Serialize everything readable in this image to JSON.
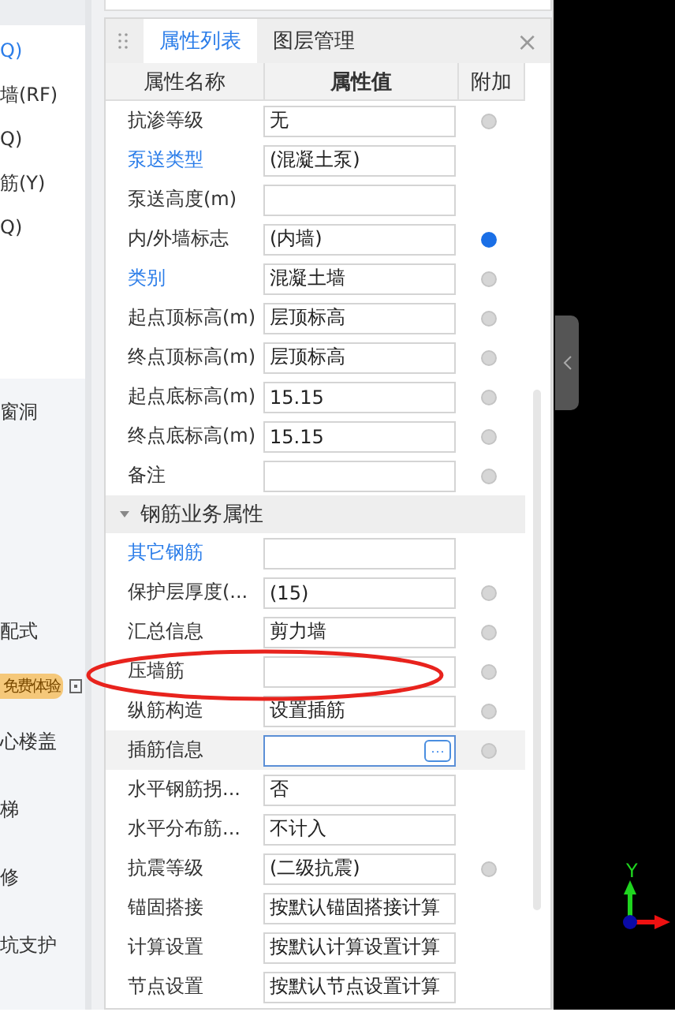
{
  "sidebar": {
    "items": [
      {
        "label": "Q)",
        "link": true
      },
      {
        "label": "墙(RF)",
        "link": false
      },
      {
        "label": "Q)",
        "link": false
      },
      {
        "label": "筋(Y)",
        "link": false
      },
      {
        "label": "Q)",
        "link": false
      }
    ],
    "groups": [
      {
        "kind": "item",
        "label": "窗洞"
      },
      {
        "kind": "item",
        "label": "配式"
      },
      {
        "kind": "badge",
        "label": "免费体验"
      },
      {
        "kind": "item",
        "label": "心楼盖"
      },
      {
        "kind": "item",
        "label": "梯"
      },
      {
        "kind": "item",
        "label": "修"
      },
      {
        "kind": "item",
        "label": "坑支护"
      }
    ]
  },
  "panel": {
    "tabs": [
      {
        "label": "属性列表",
        "selected": true
      },
      {
        "label": "图层管理",
        "selected": false
      }
    ],
    "close": "×",
    "columns": [
      "属性名称",
      "属性值",
      "附加"
    ],
    "rows": [
      {
        "kind": "text",
        "name": "抗渗等级",
        "value": "无",
        "link": false,
        "attached": false,
        "selected": false
      },
      {
        "kind": "text",
        "name": "泵送类型",
        "value": "(混凝土泵)",
        "link": true,
        "selected": false
      },
      {
        "kind": "text",
        "name": "泵送高度(m)",
        "value": "",
        "link": false,
        "selected": false
      },
      {
        "kind": "text",
        "name": "内/外墙标志",
        "value": "(内墙)",
        "link": false,
        "attached": true,
        "selected": false
      },
      {
        "kind": "text",
        "name": "类别",
        "value": "混凝土墙",
        "link": true,
        "attached": false,
        "selected": false
      },
      {
        "kind": "text",
        "name": "起点顶标高(m)",
        "value": "层顶标高",
        "link": false,
        "attached": false,
        "selected": false
      },
      {
        "kind": "text",
        "name": "终点顶标高(m)",
        "value": "层顶标高",
        "link": false,
        "attached": false,
        "selected": false
      },
      {
        "kind": "text",
        "name": "起点底标高(m)",
        "value": "15.15",
        "link": false,
        "attached": false,
        "selected": false
      },
      {
        "kind": "text",
        "name": "终点底标高(m)",
        "value": "15.15",
        "link": false,
        "attached": false,
        "selected": false
      },
      {
        "kind": "text",
        "name": "备注",
        "value": "",
        "link": false,
        "attached": false,
        "selected": false
      },
      {
        "kind": "section",
        "name": "钢筋业务属性",
        "expanded": true
      },
      {
        "kind": "text",
        "name": "其它钢筋",
        "value": "",
        "link": true,
        "selected": false
      },
      {
        "kind": "text",
        "name": "保护层厚度(...",
        "value": "(15)",
        "link": false,
        "attached": false,
        "selected": false
      },
      {
        "kind": "text",
        "name": "汇总信息",
        "value": "剪力墙",
        "link": false,
        "attached": false,
        "selected": false
      },
      {
        "kind": "text",
        "name": "压墙筋",
        "value": "",
        "link": false,
        "attached": false,
        "selected": false
      },
      {
        "kind": "text",
        "name": "纵筋构造",
        "value": "设置插筋",
        "link": false,
        "attached": false,
        "selected": false
      },
      {
        "kind": "picker",
        "name": "插筋信息",
        "value": "",
        "button": "···",
        "link": false,
        "attached": false,
        "selected": true
      },
      {
        "kind": "text",
        "name": "水平钢筋拐...",
        "value": "否",
        "link": false,
        "selected": false
      },
      {
        "kind": "text",
        "name": "水平分布筋...",
        "value": "不计入",
        "link": false,
        "selected": false
      },
      {
        "kind": "text",
        "name": "抗震等级",
        "value": "(二级抗震)",
        "link": false,
        "attached": false,
        "selected": false
      },
      {
        "kind": "text",
        "name": "锚固搭接",
        "value": "按默认锚固搭接计算",
        "link": false,
        "selected": false
      },
      {
        "kind": "text",
        "name": "计算设置",
        "value": "按默认计算设置计算",
        "link": false,
        "selected": false
      },
      {
        "kind": "text",
        "name": "节点设置",
        "value": "按默认节点设置计算",
        "link": false,
        "selected": false
      }
    ]
  },
  "viewport": {
    "axis_label": "Y"
  }
}
